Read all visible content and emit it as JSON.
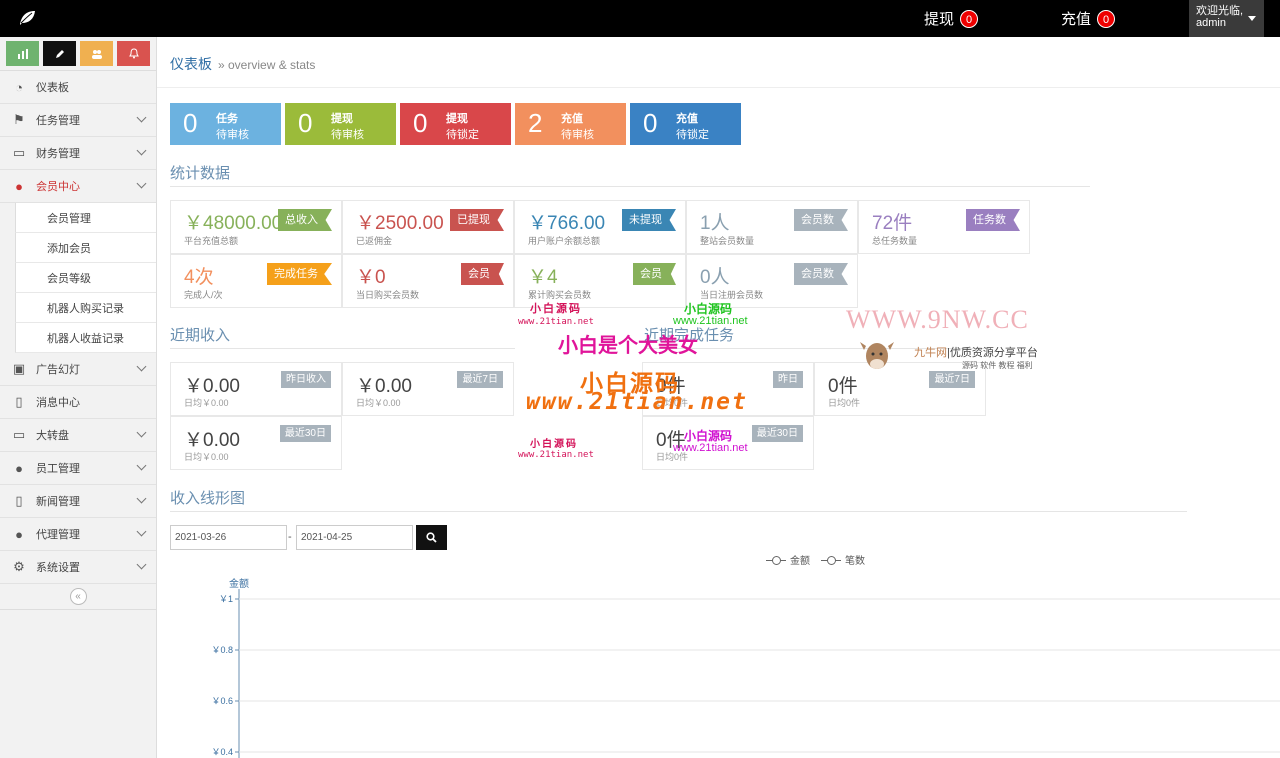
{
  "topbar": {
    "withdraw_label": "提现",
    "withdraw_count": "0",
    "recharge_label": "充值",
    "recharge_count": "0",
    "welcome": "欢迎光临,",
    "username": "admin"
  },
  "sidebar": {
    "shortcuts": [
      {
        "icon": "chart-icon",
        "color": "#6fb36f"
      },
      {
        "icon": "pencil-icon",
        "color": "#111111"
      },
      {
        "icon": "users-icon",
        "color": "#f0b050"
      },
      {
        "icon": "bell-icon",
        "color": "#d9534f"
      }
    ],
    "items": [
      {
        "label": "仪表板",
        "icon": "dashboard-icon"
      },
      {
        "label": "任务管理",
        "icon": "flag-icon"
      },
      {
        "label": "财务管理",
        "icon": "inbox-icon"
      },
      {
        "label": "会员中心",
        "icon": "user-icon"
      },
      {
        "label": "广告幻灯",
        "icon": "image-icon"
      },
      {
        "label": "消息中心",
        "icon": "bookmark-icon"
      },
      {
        "label": "大转盘",
        "icon": "inbox-icon"
      },
      {
        "label": "员工管理",
        "icon": "user-icon"
      },
      {
        "label": "新闻管理",
        "icon": "bookmark-icon"
      },
      {
        "label": "代理管理",
        "icon": "user-icon"
      },
      {
        "label": "系统设置",
        "icon": "gear-icon"
      }
    ],
    "sub_items": [
      "会员管理",
      "添加会员",
      "会员等级",
      "机器人购买记录",
      "机器人收益记录"
    ]
  },
  "breadcrumb": {
    "title": "仪表板",
    "subtitle": "» overview & stats"
  },
  "tiles": [
    {
      "num": "0",
      "t1": "任务",
      "t2": "待审核",
      "color": "#6cb2e0"
    },
    {
      "num": "0",
      "t1": "提现",
      "t2": "待审核",
      "color": "#9bbb3a"
    },
    {
      "num": "0",
      "t1": "提现",
      "t2": "待锁定",
      "color": "#d9474a"
    },
    {
      "num": "2",
      "t1": "充值",
      "t2": "待审核",
      "color": "#f2905e"
    },
    {
      "num": "0",
      "t1": "充值",
      "t2": "待锁定",
      "color": "#3a82c4"
    }
  ],
  "stats_title": "统计数据",
  "stats": [
    {
      "value": "￥48000.00",
      "label": "平台充值总额",
      "tag": "总收入",
      "color": "#87b15a"
    },
    {
      "value": "￥2500.00",
      "label": "已返佣金",
      "tag": "已提现",
      "color": "#c9534f"
    },
    {
      "value": "￥766.00",
      "label": "用户账户余额总额",
      "tag": "未提现",
      "color": "#3a86b4"
    },
    {
      "value": "1人",
      "label": "整站会员数量",
      "tag": "会员数",
      "color": "#a8b3bc"
    },
    {
      "value": "72件",
      "label": "总任务数量",
      "tag": "任务数",
      "color": "#9a7fc0"
    },
    {
      "value": "4次",
      "label": "完成人/次",
      "tag": "完成任务",
      "color": "#f5a01a"
    },
    {
      "value": "￥0",
      "label": "当日购买会员数",
      "tag": "会员",
      "color": "#c9534f"
    },
    {
      "value": "￥4",
      "label": "累计购买会员数",
      "tag": "会员",
      "color": "#87b15a"
    },
    {
      "value": "0人",
      "label": "当日注册会员数",
      "tag": "会员数",
      "color": "#a8b3bc"
    }
  ],
  "income_title": "近期收入",
  "income": [
    {
      "value": "￥0.00",
      "label": "日均￥0.00",
      "tag": "昨日收入"
    },
    {
      "value": "￥0.00",
      "label": "日均￥0.00",
      "tag": "最近7日"
    },
    {
      "value": "￥0.00",
      "label": "日均￥0.00",
      "tag": "最近30日"
    }
  ],
  "tasks_title": "近期完成任务",
  "tasks": [
    {
      "value": "0件",
      "label": "日均0件",
      "tag": "昨日"
    },
    {
      "value": "0件",
      "label": "日均0件",
      "tag": "最近7日"
    },
    {
      "value": "0件",
      "label": "日均0件",
      "tag": "最近30日"
    }
  ],
  "chart_section_title": "收入线形图",
  "date_from": "2021-03-26",
  "date_to": "2021-04-25",
  "date_separator": "-",
  "chart_data": {
    "type": "line",
    "ylabel": "金额",
    "yticks": [
      "￥1",
      "￥0.8",
      "￥0.6",
      "￥0.4"
    ],
    "series": [
      {
        "name": "金额",
        "values": []
      },
      {
        "name": "笔数",
        "values": []
      }
    ],
    "grid": true,
    "legend": "top-center"
  },
  "watermarks": {
    "w1": "小白源码",
    "w1_url": "www.21tian.net",
    "w2": "小白是个大美女",
    "w3": "小白源码",
    "w3_url": "www.21tian.net",
    "w4": "WWW.9NW.CC",
    "w5": "九牛网",
    "w5_sub": "优质资源分享平台",
    "w5_tags": "源码 软件 教程 福利"
  }
}
